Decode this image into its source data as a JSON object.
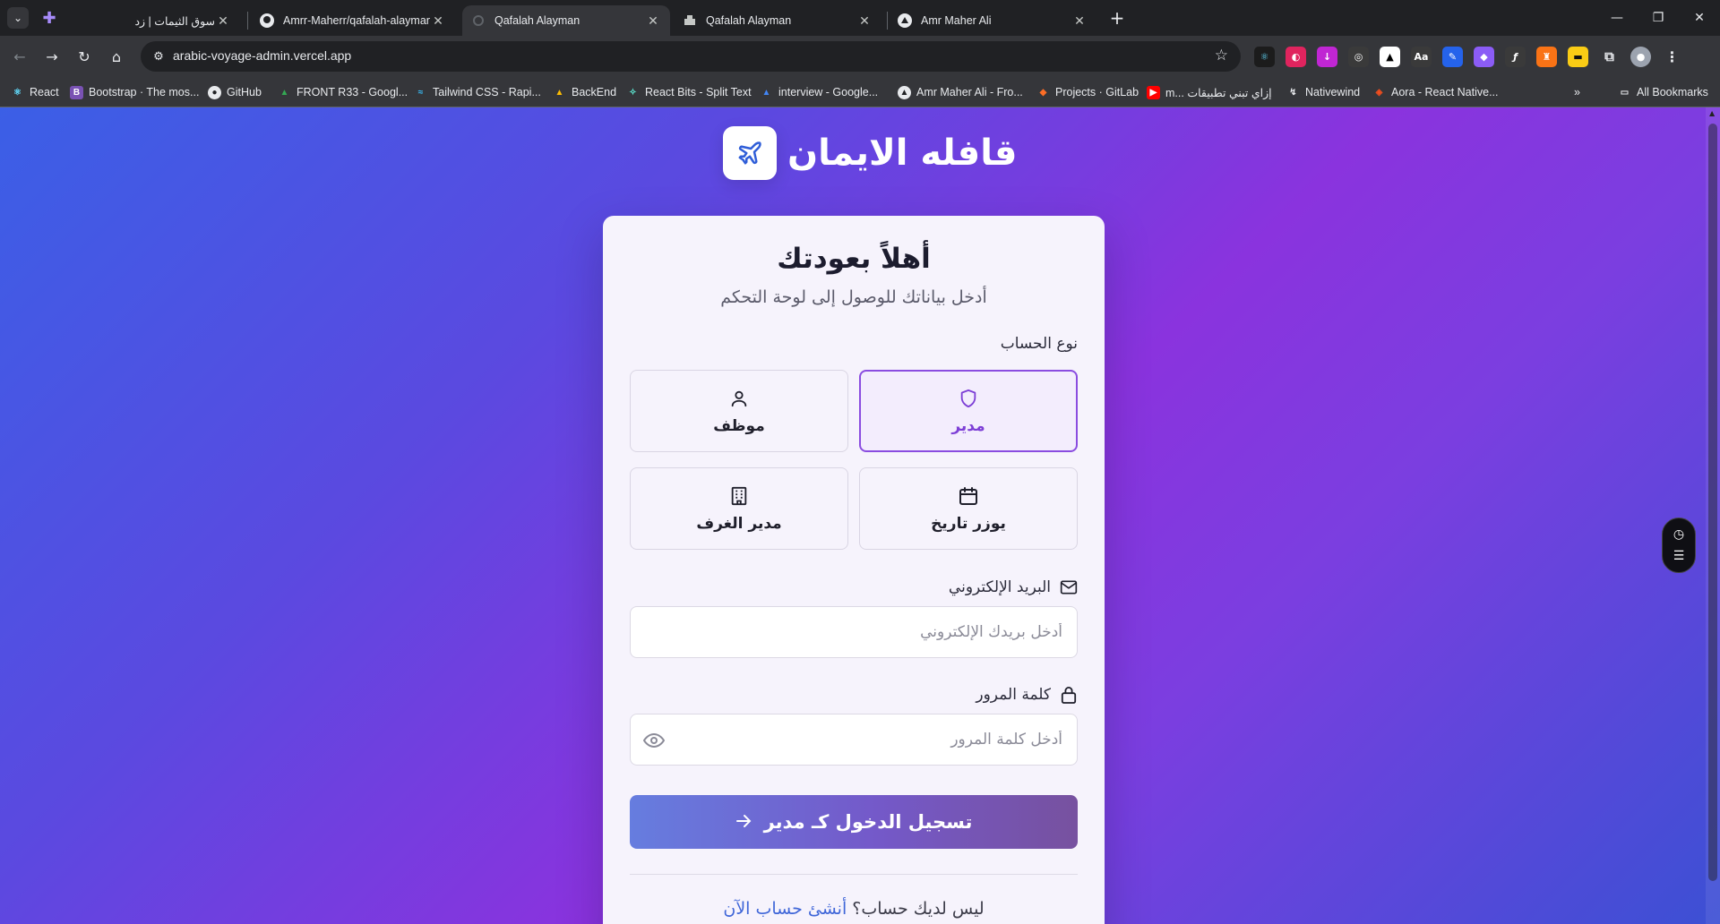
{
  "browser": {
    "tabs": [
      {
        "title": "سوق الثيمات | زد",
        "active": false
      },
      {
        "title": "Amrr-Maherr/qafalah-alayman-",
        "active": false
      },
      {
        "title": "Qafalah Alayman",
        "active": true
      },
      {
        "title": "Qafalah Alayman",
        "active": false
      },
      {
        "title": "Amr Maher Ali",
        "active": false
      }
    ],
    "new_tab": "+",
    "url": "arabic-voyage-admin.vercel.app",
    "bookmarks": [
      "React",
      "Bootstrap · The mos...",
      "GitHub",
      "FRONT R33 - Googl...",
      "Tailwind CSS - Rapi...",
      "BackEnd",
      "React Bits - Split Text",
      "interview - Google...",
      "Amr Maher Ali - Fro...",
      "Projects · GitLab",
      "m... إزاي تبني تطبيقات",
      "Nativewind",
      "Aora - React Native...",
      "All Bookmarks"
    ],
    "accent_colors": {
      "page_gradient_start": "#3b5fe6",
      "page_gradient_mid": "#8a33de",
      "selected_role": "#8a4ce0",
      "link": "#3f66d8"
    }
  },
  "page": {
    "brand_name": "قافله الايمان",
    "title": "أهلاً بعودتك",
    "subtitle": "أدخل بياناتك للوصول إلى لوحة التحكم",
    "account_type_label": "نوع الحساب",
    "roles": [
      {
        "label": "مدير",
        "icon": "shield-icon",
        "selected": true
      },
      {
        "label": "موظف",
        "icon": "user-icon",
        "selected": false
      },
      {
        "label": "يوزر تاريخ",
        "icon": "calendar-icon",
        "selected": false
      },
      {
        "label": "مدير الغرف",
        "icon": "building-icon",
        "selected": false
      }
    ],
    "email": {
      "label": "البريد الإلكتروني",
      "placeholder": "أدخل بريدك الإلكتروني",
      "value": ""
    },
    "password": {
      "label": "كلمة المرور",
      "placeholder": "أدخل كلمة المرور",
      "value": ""
    },
    "submit_label": "تسجيل الدخول كـ مدير",
    "signup_prompt": "ليس لديك حساب؟",
    "signup_link": "أنشئ حساب الآن"
  }
}
